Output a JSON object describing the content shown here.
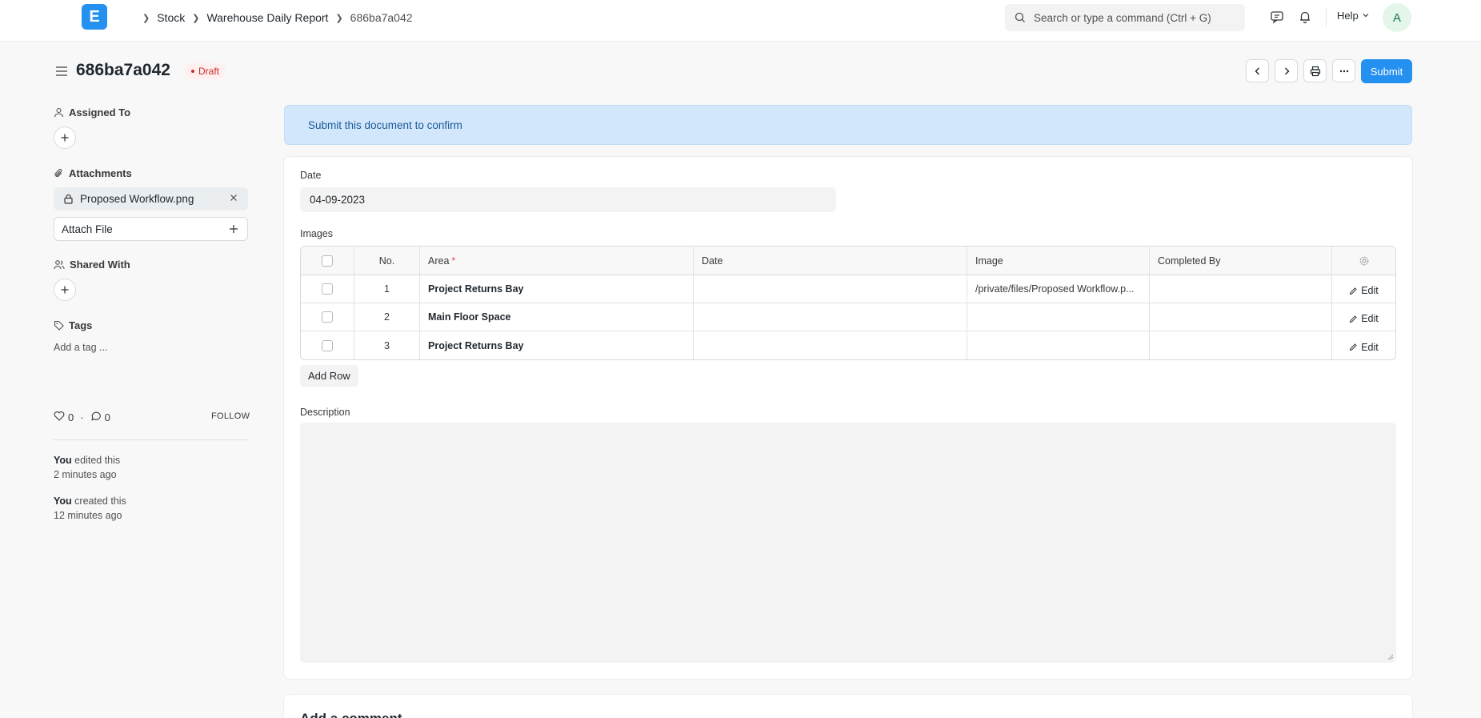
{
  "navbar": {
    "logo_letter": "E",
    "breadcrumbs": [
      "Stock",
      "Warehouse Daily Report",
      "686ba7a042"
    ],
    "search_placeholder": "Search or type a command (Ctrl + G)",
    "help_label": "Help",
    "avatar_initial": "A"
  },
  "doc": {
    "title": "686ba7a042",
    "status": "Draft",
    "submit_label": "Submit"
  },
  "sidebar": {
    "assigned_to_label": "Assigned To",
    "attachments_label": "Attachments",
    "attachment_name": "Proposed Workflow.png",
    "attach_file_label": "Attach File",
    "shared_with_label": "Shared With",
    "tags_label": "Tags",
    "add_tag_label": "Add a tag ...",
    "likes_count": "0",
    "comments_count": "0",
    "follow_label": "FOLLOW",
    "timeline": [
      {
        "who": "You",
        "action": " edited this",
        "when": "2 minutes ago"
      },
      {
        "who": "You",
        "action": " created this",
        "when": "12 minutes ago"
      }
    ]
  },
  "form": {
    "alert": "Submit this document to confirm",
    "date_label": "Date",
    "date_value": "04-09-2023",
    "images_label": "Images",
    "columns": [
      "No.",
      "Area",
      "Date",
      "Image",
      "Completed By"
    ],
    "rows": [
      {
        "no": "1",
        "area": "Project Returns Bay",
        "date": "",
        "image": "/private/files/Proposed Workflow.p...",
        "completed_by": "",
        "action": "Edit"
      },
      {
        "no": "2",
        "area": "Main Floor Space",
        "date": "",
        "image": "",
        "completed_by": "",
        "action": "Edit"
      },
      {
        "no": "3",
        "area": "Project Returns Bay",
        "date": "",
        "image": "",
        "completed_by": "",
        "action": "Edit"
      }
    ],
    "add_row_label": "Add Row",
    "description_label": "Description",
    "next_section_title": "Add a comment"
  },
  "colors": {
    "primary": "#2490ef",
    "alert_bg": "#d2e7fc",
    "draft": "#cc2929"
  }
}
